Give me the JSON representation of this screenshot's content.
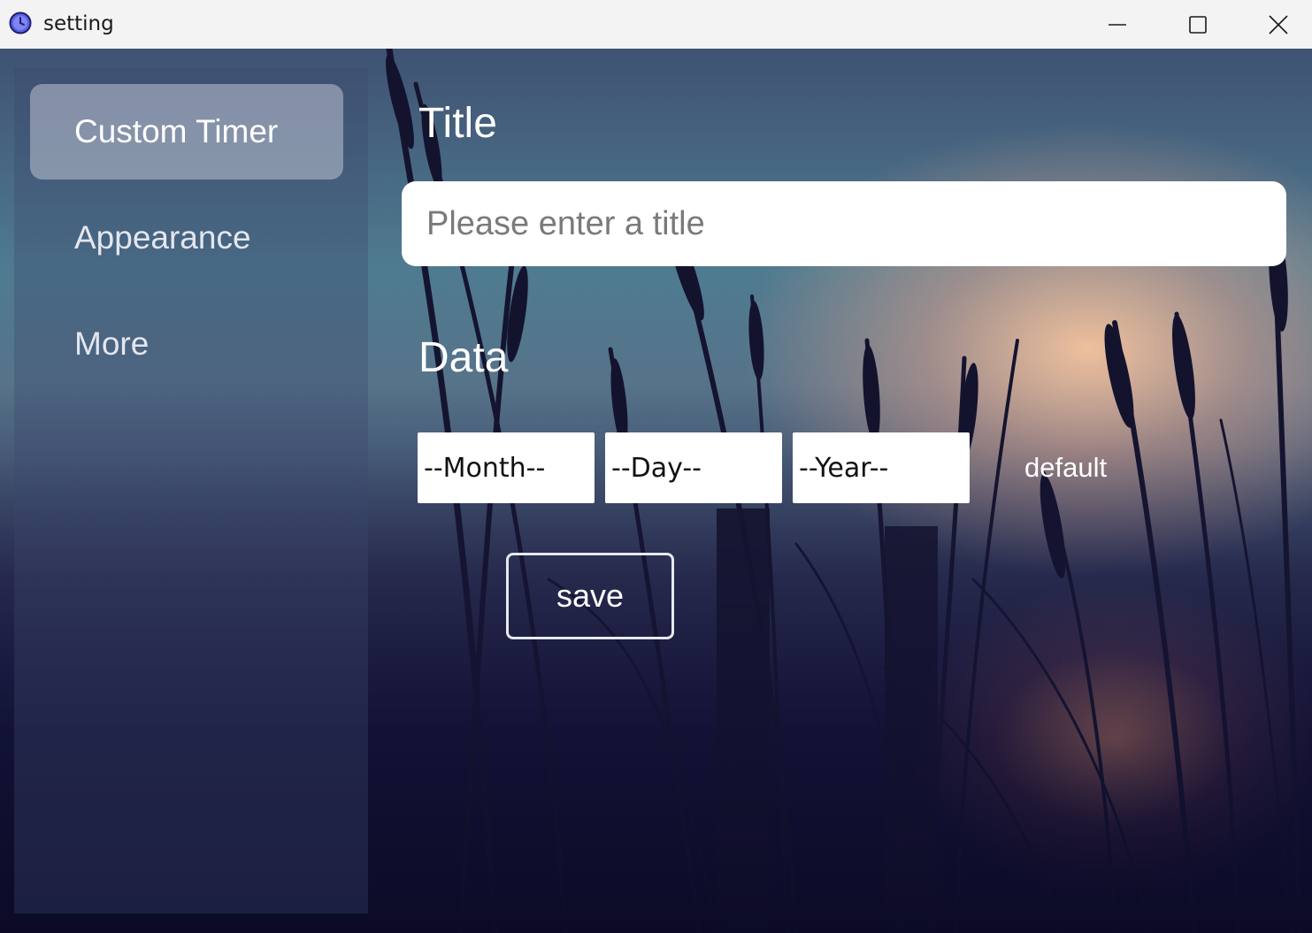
{
  "window": {
    "title": "setting",
    "icon": "clock-icon",
    "controls": [
      "minimize-icon",
      "maximize-icon",
      "close-icon"
    ]
  },
  "sidebar": {
    "items": [
      {
        "label": "Custom Timer",
        "active": true
      },
      {
        "label": "Appearance",
        "active": false
      },
      {
        "label": "More",
        "active": false
      }
    ]
  },
  "form": {
    "title_label": "Title",
    "title_placeholder": "Please enter a title",
    "title_value": "",
    "data_label": "Data",
    "month_select": "--Month--",
    "day_select": "--Day--",
    "year_select": "--Year--",
    "default_link": "default",
    "save_label": "save"
  },
  "colors": {
    "titlebar_bg": "#f3f3f3",
    "active_nav_bg": "#bec2d2",
    "input_bg": "#ffffff",
    "text_light": "#ffffff"
  }
}
